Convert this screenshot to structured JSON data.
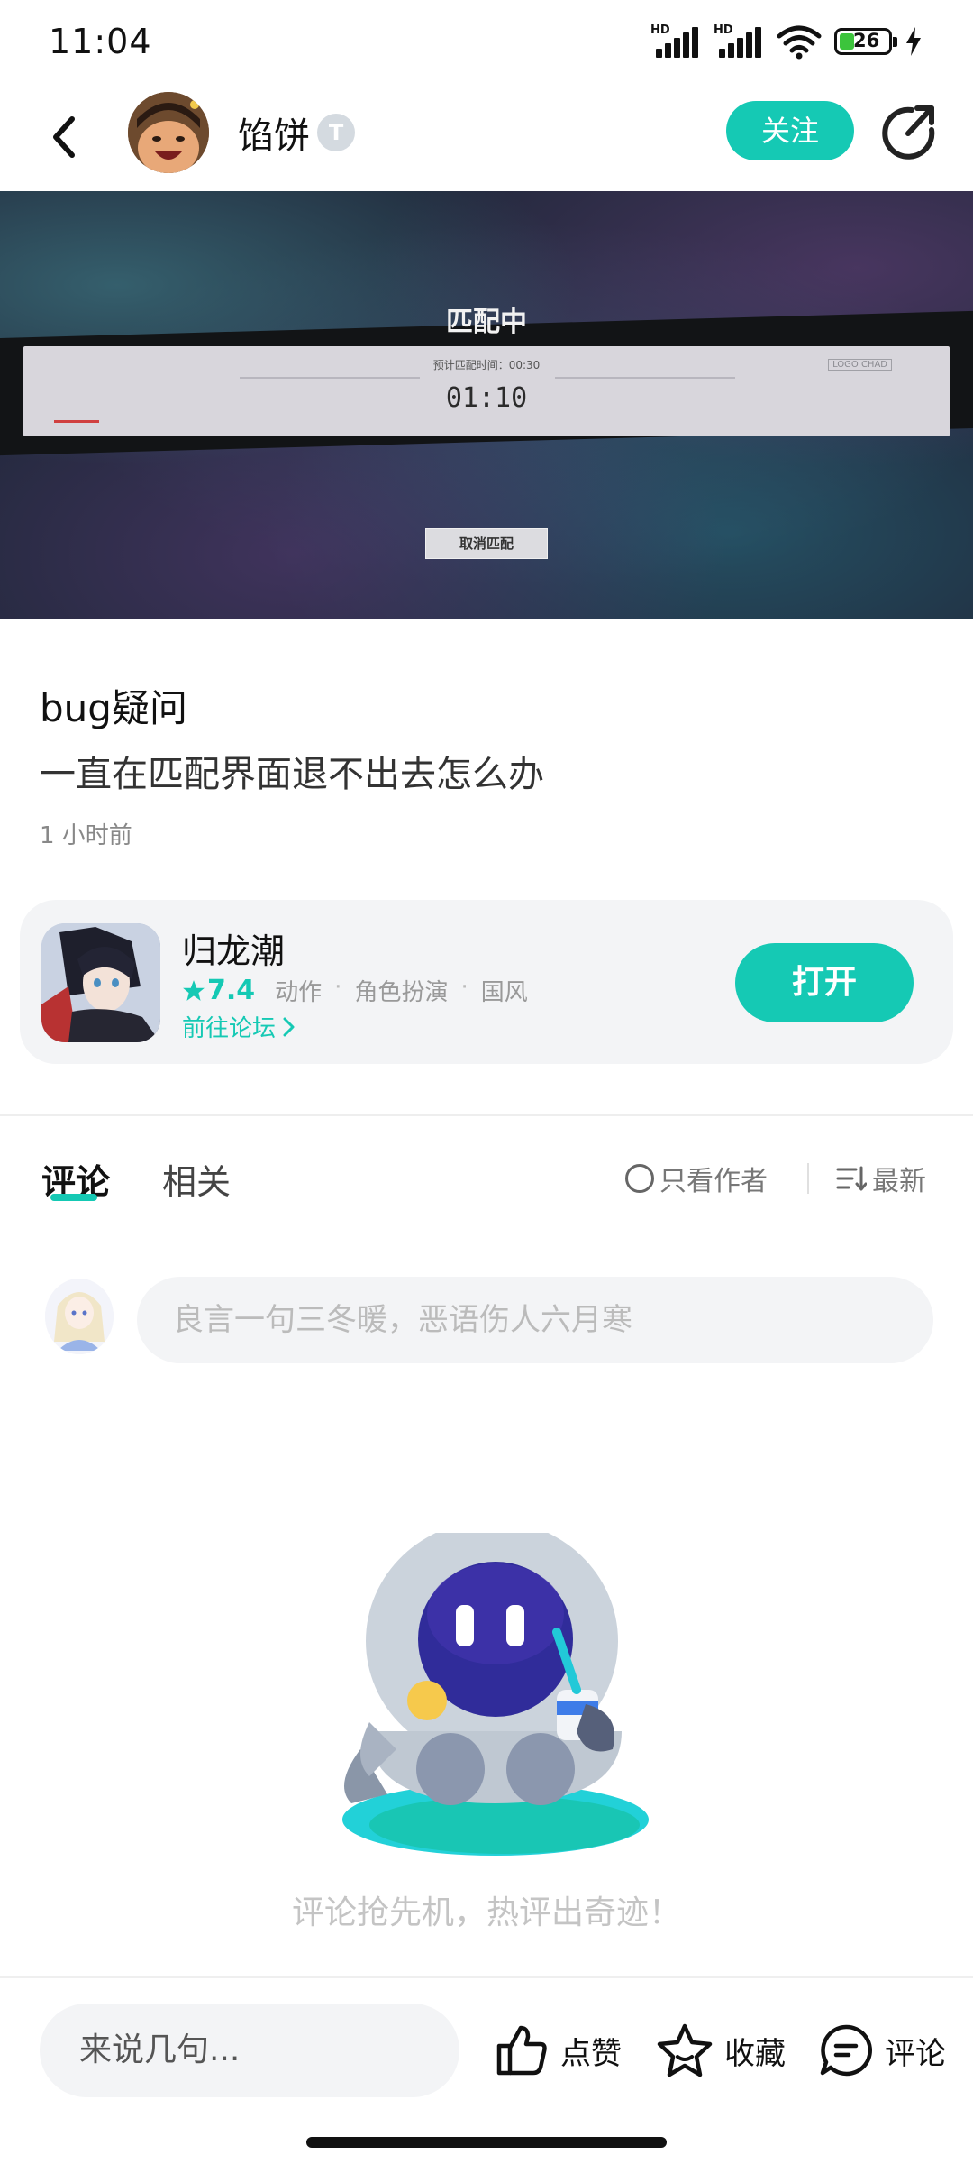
{
  "status_bar": {
    "time": "11:04",
    "signal_label_1": "HD",
    "signal_label_2": "HD",
    "battery_level": "26",
    "icons": [
      "signal-icon",
      "signal-icon",
      "wifi-icon",
      "battery-icon",
      "charging-bolt-icon"
    ]
  },
  "header": {
    "author_name": "馅饼",
    "level_badge": "T",
    "follow_label": "关注",
    "icons": [
      "back-arrow-icon",
      "share-icon"
    ]
  },
  "hero": {
    "title": "匹配中",
    "estimate": "预计匹配时间：00:30",
    "timer": "01:10",
    "cancel_label": "取消匹配",
    "brand": "LOGO CHAD"
  },
  "post": {
    "title": "bug疑问",
    "body": "一直在匹配界面退不出去怎么办",
    "time": "1 小时前"
  },
  "game_card": {
    "name": "归龙潮",
    "rating": "7.4",
    "tags": [
      "动作",
      "角色扮演",
      "国风"
    ],
    "forum_link": "前往论坛",
    "open_label": "打开",
    "colors": {
      "accent": "#15c9b4"
    }
  },
  "comments": {
    "tabs": [
      "评论",
      "相关"
    ],
    "author_only_label": "只看作者",
    "sort_label": "最新",
    "input_placeholder": "良言一句三冬暖，恶语伤人六月寒",
    "empty_text": "评论抢先机，热评出奇迹！"
  },
  "bottom_bar": {
    "reply_placeholder": "来说几句...",
    "like_label": "点赞",
    "favorite_label": "收藏",
    "comment_label": "评论",
    "icons": [
      "thumbs-up-icon",
      "star-icon",
      "comment-bubble-icon"
    ]
  }
}
